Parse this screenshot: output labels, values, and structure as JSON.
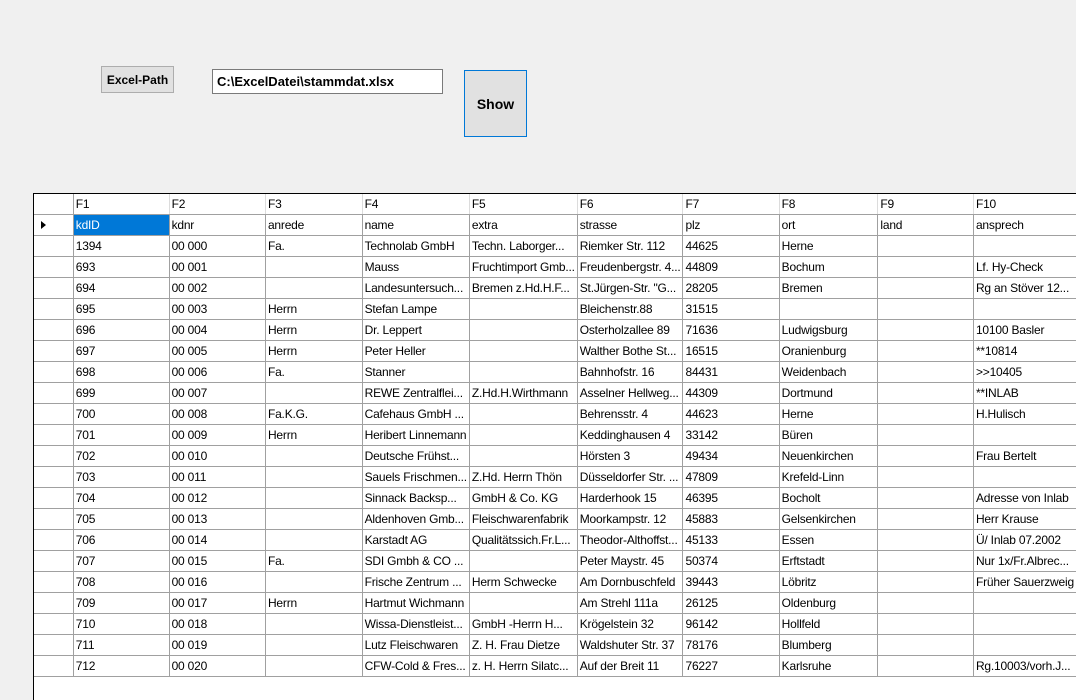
{
  "toolbar": {
    "excel_path_label": "Excel-Path",
    "path_value": "C:\\ExcelDatei\\stammdat.xlsx",
    "show_label": "Show"
  },
  "grid": {
    "columns": [
      "F1",
      "F2",
      "F3",
      "F4",
      "F5",
      "F6",
      "F7",
      "F8",
      "F9",
      "F10"
    ],
    "rows": [
      [
        "kdID",
        "kdnr",
        "anrede",
        "name",
        "extra",
        "strasse",
        "plz",
        "ort",
        "land",
        "ansprech"
      ],
      [
        "1394",
        "00 000",
        "Fa.",
        "Technolab GmbH",
        "Techn. Laborger...",
        "Riemker Str. 112",
        "44625",
        "Herne",
        "",
        ""
      ],
      [
        "693",
        "00 001",
        "",
        "Mauss",
        "Fruchtimport Gmb...",
        "Freudenbergstr. 4...",
        "44809",
        "Bochum",
        "",
        "Lf. Hy-Check"
      ],
      [
        "694",
        "00 002",
        "",
        "Landesuntersuch...",
        "Bremen z.Hd.H.F...",
        "St.Jürgen-Str. \"G...",
        "28205",
        "Bremen",
        "",
        "Rg an Stöver 12..."
      ],
      [
        "695",
        "00 003",
        "Herrn",
        "Stefan Lampe",
        "",
        "Bleichenstr.88",
        "31515",
        "",
        "",
        ""
      ],
      [
        "696",
        "00 004",
        "Herrn",
        "Dr. Leppert",
        "",
        "Osterholzallee 89",
        "71636",
        "Ludwigsburg",
        "",
        "10100 Basler"
      ],
      [
        "697",
        "00 005",
        "Herrn",
        "Peter Heller",
        "",
        "Walther Bothe St...",
        "16515",
        "Oranienburg",
        "",
        "**10814"
      ],
      [
        "698",
        "00 006",
        "Fa.",
        "Stanner",
        "",
        "Bahnhofstr. 16",
        "84431",
        "Weidenbach",
        "",
        ">>10405"
      ],
      [
        "699",
        "00 007",
        "",
        "REWE Zentralflei...",
        "Z.Hd.H.Wirthmann",
        "Asselner Hellweg...",
        "44309",
        "Dortmund",
        "",
        "**INLAB"
      ],
      [
        "700",
        "00 008",
        "Fa.K.G.",
        "Cafehaus GmbH ...",
        "",
        "Behrensstr. 4",
        "44623",
        "Herne",
        "",
        "H.Hulisch"
      ],
      [
        "701",
        "00 009",
        "Herrn",
        "Heribert Linnemann",
        "",
        "Keddinghausen 4",
        "33142",
        "Büren",
        "",
        ""
      ],
      [
        "702",
        "00 010",
        "",
        "Deutsche Frühst...",
        "",
        "Hörsten 3",
        "49434",
        "Neuenkirchen",
        "",
        "Frau Bertelt"
      ],
      [
        "703",
        "00 011",
        "",
        "Sauels Frischmen...",
        "Z.Hd. Herrn Thön",
        "Düsseldorfer Str. ...",
        "47809",
        "Krefeld-Linn",
        "",
        ""
      ],
      [
        "704",
        "00 012",
        "",
        "Sinnack Backsp...",
        "GmbH & Co. KG",
        "Harderhook 15",
        "46395",
        "Bocholt",
        "",
        "Adresse von Inlab"
      ],
      [
        "705",
        "00 013",
        "",
        "Aldenhoven Gmb...",
        "Fleischwarenfabrik",
        "Moorkampstr. 12",
        "45883",
        "Gelsenkirchen",
        "",
        "Herr Krause"
      ],
      [
        "706",
        "00 014",
        "",
        "Karstadt AG",
        "Qualitätssich.Fr.L...",
        "Theodor-Althoffst...",
        "45133",
        "Essen",
        "",
        "Ü/ Inlab 07.2002"
      ],
      [
        "707",
        "00 015",
        "Fa.",
        "SDI  Gmbh & CO ...",
        "",
        "Peter Maystr. 45",
        "50374",
        "Erftstadt",
        "",
        "Nur 1x/Fr.Albrec..."
      ],
      [
        "708",
        "00 016",
        "",
        "Frische Zentrum ...",
        "Herm Schwecke",
        "Am Dornbuschfeld",
        "39443",
        "Löbritz",
        "",
        "Früher Sauerzweig"
      ],
      [
        "709",
        "00 017",
        "Herrn",
        "Hartmut Wichmann",
        "",
        "Am Strehl 111a",
        "26125",
        "Oldenburg",
        "",
        ""
      ],
      [
        "710",
        "00 018",
        "",
        "Wissa-Dienstleist...",
        "GmbH  -Herrn H...",
        "Krögelstein 32",
        "96142",
        "Hollfeld",
        "",
        ""
      ],
      [
        "711",
        "00 019",
        "",
        "Lutz Fleischwaren",
        "Z. H. Frau Dietze",
        "Waldshuter Str. 37",
        "78176",
        "Blumberg",
        "",
        ""
      ],
      [
        "712",
        "00 020",
        "",
        "CFW-Cold & Fres...",
        "z. H. Herrn Silatc...",
        "Auf der Breit 11",
        "76227",
        "Karlsruhe",
        "",
        "Rg.10003/vorh.J..."
      ]
    ]
  }
}
